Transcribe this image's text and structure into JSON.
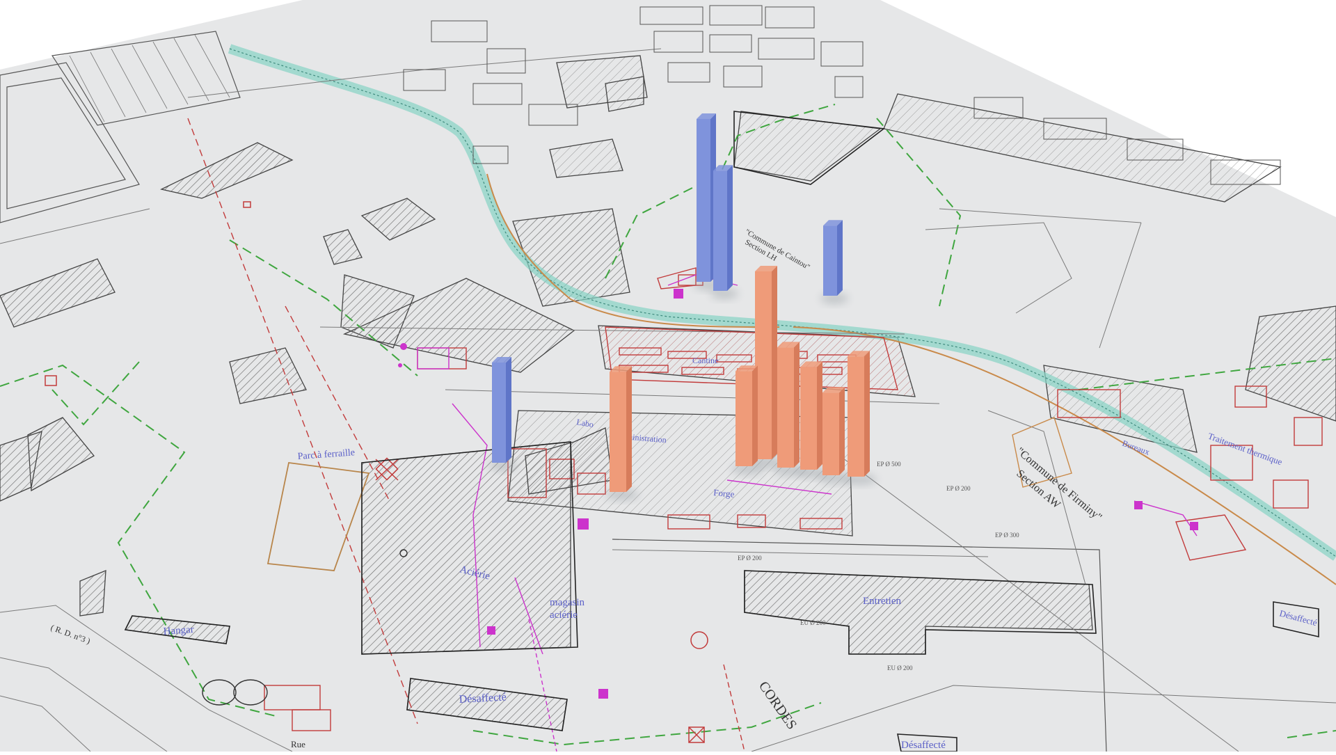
{
  "scene": {
    "description_visible": false,
    "paper_color": "#e6e7e8",
    "background_color": "#ffffff"
  },
  "map_labels": {
    "commune_firminy": "\"Commune de Firminy\"",
    "section_aw": "Section AW",
    "commune_caintou": "\"Commune de Caintou\"",
    "section_lh": "Section LH",
    "parc_ferraille": "Parc à ferraille",
    "acierie": "Aciérie",
    "magasin_acierie_1": "magasin",
    "magasin_acierie_2": "aciérie",
    "hangar": "Hangar",
    "desaffecte_1": "Désaffecté",
    "desaffecte_2": "Désaffecté",
    "desaffecte_3": "Désaffecté",
    "entretien": "Entretien",
    "forge": "Forge",
    "labo": "Labo",
    "administration": "Administration",
    "cordes": "CORDES",
    "rue": "Rue",
    "rd": "( R. D. n°3 )",
    "bureaux": "Bureaux",
    "traitement_thermique": "Traitement thermique",
    "canteen": "Cantine",
    "eu_200": "EU Ø 200",
    "ep_200": "EP Ø 200",
    "ep_500": "EP Ø 500",
    "ep_300": "EP Ø 300"
  },
  "colors": {
    "bar_blue": "#7f93dc",
    "bar_blue_side": "#5f75c8",
    "bar_orange": "#ef9b79",
    "bar_orange_side": "#d77c5b",
    "line_green": "#3fa63f",
    "line_red": "#c23b3b",
    "line_magenta": "#cc33cc",
    "line_orange": "#c98a4a",
    "line_dark": "#333333",
    "stream": "#86d3c4",
    "label_blue": "#5a5fc8"
  },
  "chart_data": {
    "type": "bar",
    "title": "",
    "xlabel": "",
    "ylabel": "",
    "note_units": "relative heights estimated from 3D columns",
    "series": [
      {
        "color_key": "blue",
        "values": [
          0.65,
          0.48,
          0.28,
          0.4
        ]
      },
      {
        "color_key": "orange",
        "values": [
          0.48,
          0.75,
          0.38,
          0.48,
          0.41,
          0.33,
          0.48
        ]
      }
    ]
  }
}
